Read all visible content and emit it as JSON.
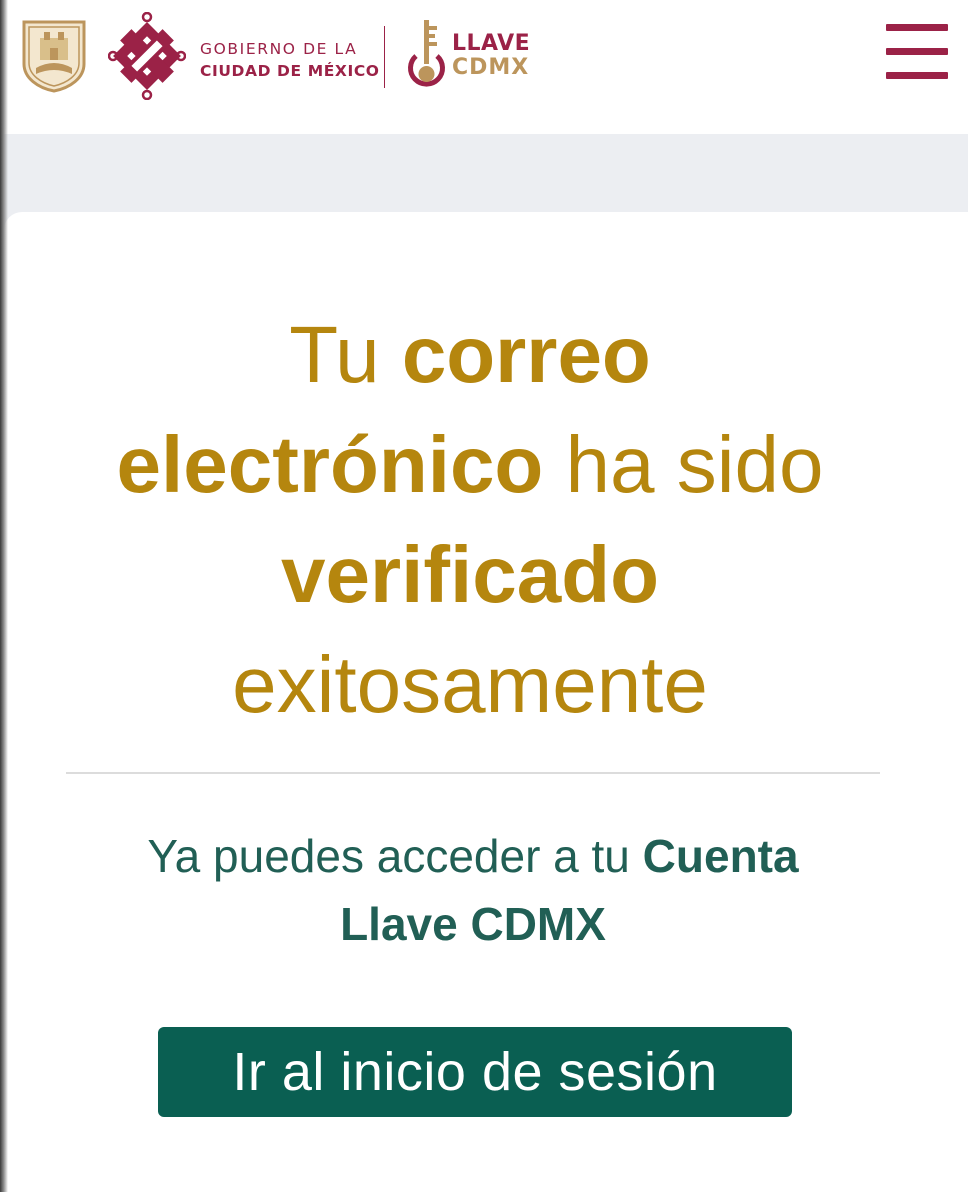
{
  "header": {
    "gov_line1": "GOBIERNO DE LA",
    "gov_line2": "CIUDAD DE MÉXICO",
    "brand_line1": "LLAVE",
    "brand_line2": "CDMX",
    "icons": [
      "shield-icon",
      "cdmx-logo-icon",
      "key-icon",
      "menu-icon"
    ]
  },
  "main": {
    "title": {
      "l1_normal": "Tu ",
      "l1_bold": "correo",
      "l2_bold": "electrónico",
      "l2_normal": " ha sido",
      "l3_bold": "verificado",
      "l4_normal": "exitosamente"
    },
    "subtitle": {
      "l1_normal": "Ya puedes acceder a tu ",
      "l1_bold": "Cuenta",
      "l2_bold": "Llave CDMX"
    },
    "button_label": "Ir al inicio de sesión"
  },
  "colors": {
    "brand_red": "#9b2247",
    "gold": "#b5860e",
    "gold_light": "#bc955c",
    "teal_text": "#215f55",
    "button_bg": "#0a5f52",
    "page_bg": "#eceef2"
  }
}
